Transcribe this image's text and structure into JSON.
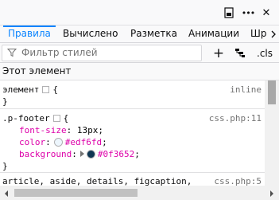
{
  "toolbar": {
    "dock_icon": "dock-side-icon",
    "more_icon": "more-icon",
    "close_icon": "close-icon",
    "more_label": "•••",
    "close_label": "✕"
  },
  "tabs": [
    {
      "label": "Правила",
      "active": true
    },
    {
      "label": "Вычислено",
      "active": false
    },
    {
      "label": "Разметка",
      "active": false
    },
    {
      "label": "Анимации",
      "active": false
    },
    {
      "label": "Шр",
      "active": false
    }
  ],
  "filter": {
    "placeholder": "Фильтр стилей",
    "add_label": "+",
    "cls_label": ".cls"
  },
  "section": {
    "title": "Этот элемент"
  },
  "rules": [
    {
      "selector": "элемент",
      "source": "inline",
      "open": "{",
      "close": "}",
      "declarations": []
    },
    {
      "selector": ".p-footer",
      "source": "css.php:11",
      "open": "{",
      "close": "}",
      "declarations": [
        {
          "prop": "font-size",
          "value": "13px"
        },
        {
          "prop": "color",
          "value": "#edf6fd",
          "swatch": "#edf6fd"
        },
        {
          "prop": "background",
          "value": "#0f3652",
          "swatch": "#0f3652"
        }
      ]
    },
    {
      "selector": "article, aside, details, figcaption,",
      "source": "css.php:5"
    }
  ],
  "colors": {
    "accent": "#0a84ff",
    "property": "#dd00a9"
  }
}
